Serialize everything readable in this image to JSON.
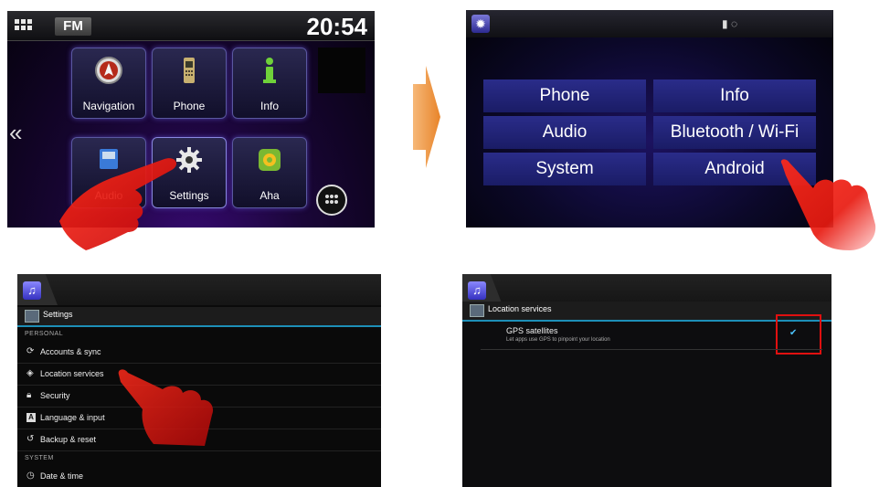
{
  "panel_home": {
    "source": "FM",
    "time": "20:54",
    "tiles": [
      "Navigation",
      "Phone",
      "Info",
      "Audio",
      "Settings",
      "Aha"
    ]
  },
  "panel_settings_menu": {
    "buttons": [
      "Phone",
      "Info",
      "Audio",
      "Bluetooth / Wi-Fi",
      "System",
      "Android"
    ]
  },
  "panel_android_settings": {
    "header": "Settings",
    "section_personal": "PERSONAL",
    "items_personal": [
      "Accounts & sync",
      "Location services",
      "Security",
      "Language & input",
      "Backup & reset"
    ],
    "section_system": "SYSTEM",
    "items_system": [
      "Date & time"
    ]
  },
  "panel_location": {
    "header": "Location services",
    "gps_title": "GPS satellites",
    "gps_subtitle": "Let apps use GPS to pinpoint your location",
    "gps_checked": true
  },
  "colors": {
    "accent_blue": "#1d8fb8",
    "highlight_red": "#e01010",
    "arrow_orange": "#f0a050",
    "menu_button": "#2a2c8a"
  }
}
